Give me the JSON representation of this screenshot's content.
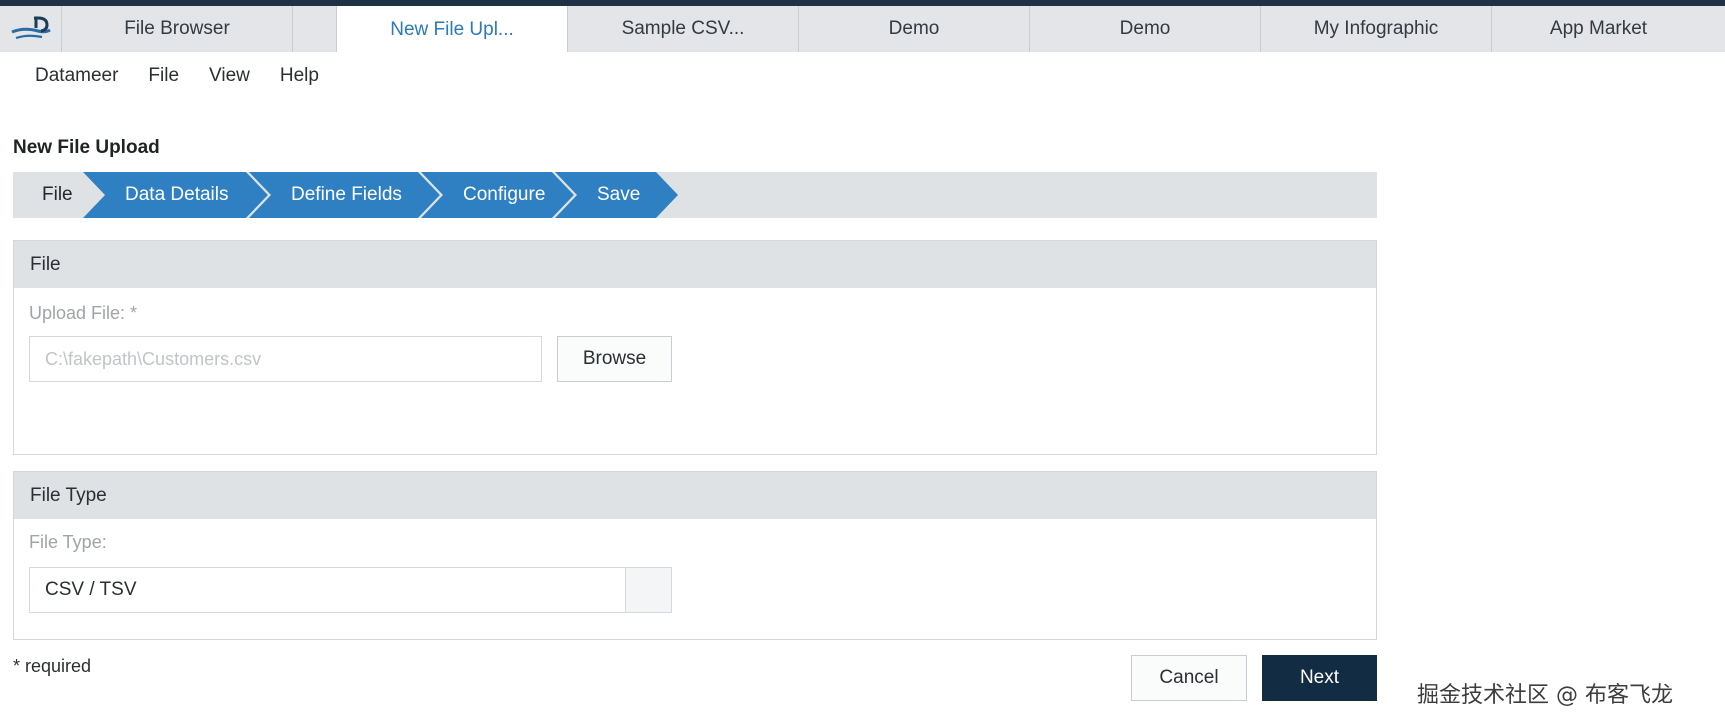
{
  "tabs": [
    {
      "label": "File Browser"
    },
    {
      "label": "New File Upl..."
    },
    {
      "label": "Sample CSV..."
    },
    {
      "label": "Demo"
    },
    {
      "label": "Demo"
    },
    {
      "label": "My Infographic"
    },
    {
      "label": "App Market"
    }
  ],
  "menu": [
    "Datameer",
    "File",
    "View",
    "Help"
  ],
  "page_title": "New File Upload",
  "wizard_steps": [
    "File",
    "Data Details",
    "Define Fields",
    "Configure",
    "Save"
  ],
  "file_panel": {
    "header": "File",
    "upload_label": "Upload File: *",
    "upload_value": "C:\\fakepath\\Customers.csv",
    "browse_label": "Browse"
  },
  "file_type_panel": {
    "header": "File Type",
    "type_label": "File Type:",
    "type_value": "CSV / TSV"
  },
  "required_note": "* required",
  "buttons": {
    "cancel": "Cancel",
    "next": "Next"
  },
  "watermark": "掘金技术社区 @ 布客飞龙",
  "colors": {
    "accent": "#2f80c2",
    "active_tab_text": "#2a7ab8",
    "primary_button": "#122c44",
    "top_border": "#1e3246"
  }
}
